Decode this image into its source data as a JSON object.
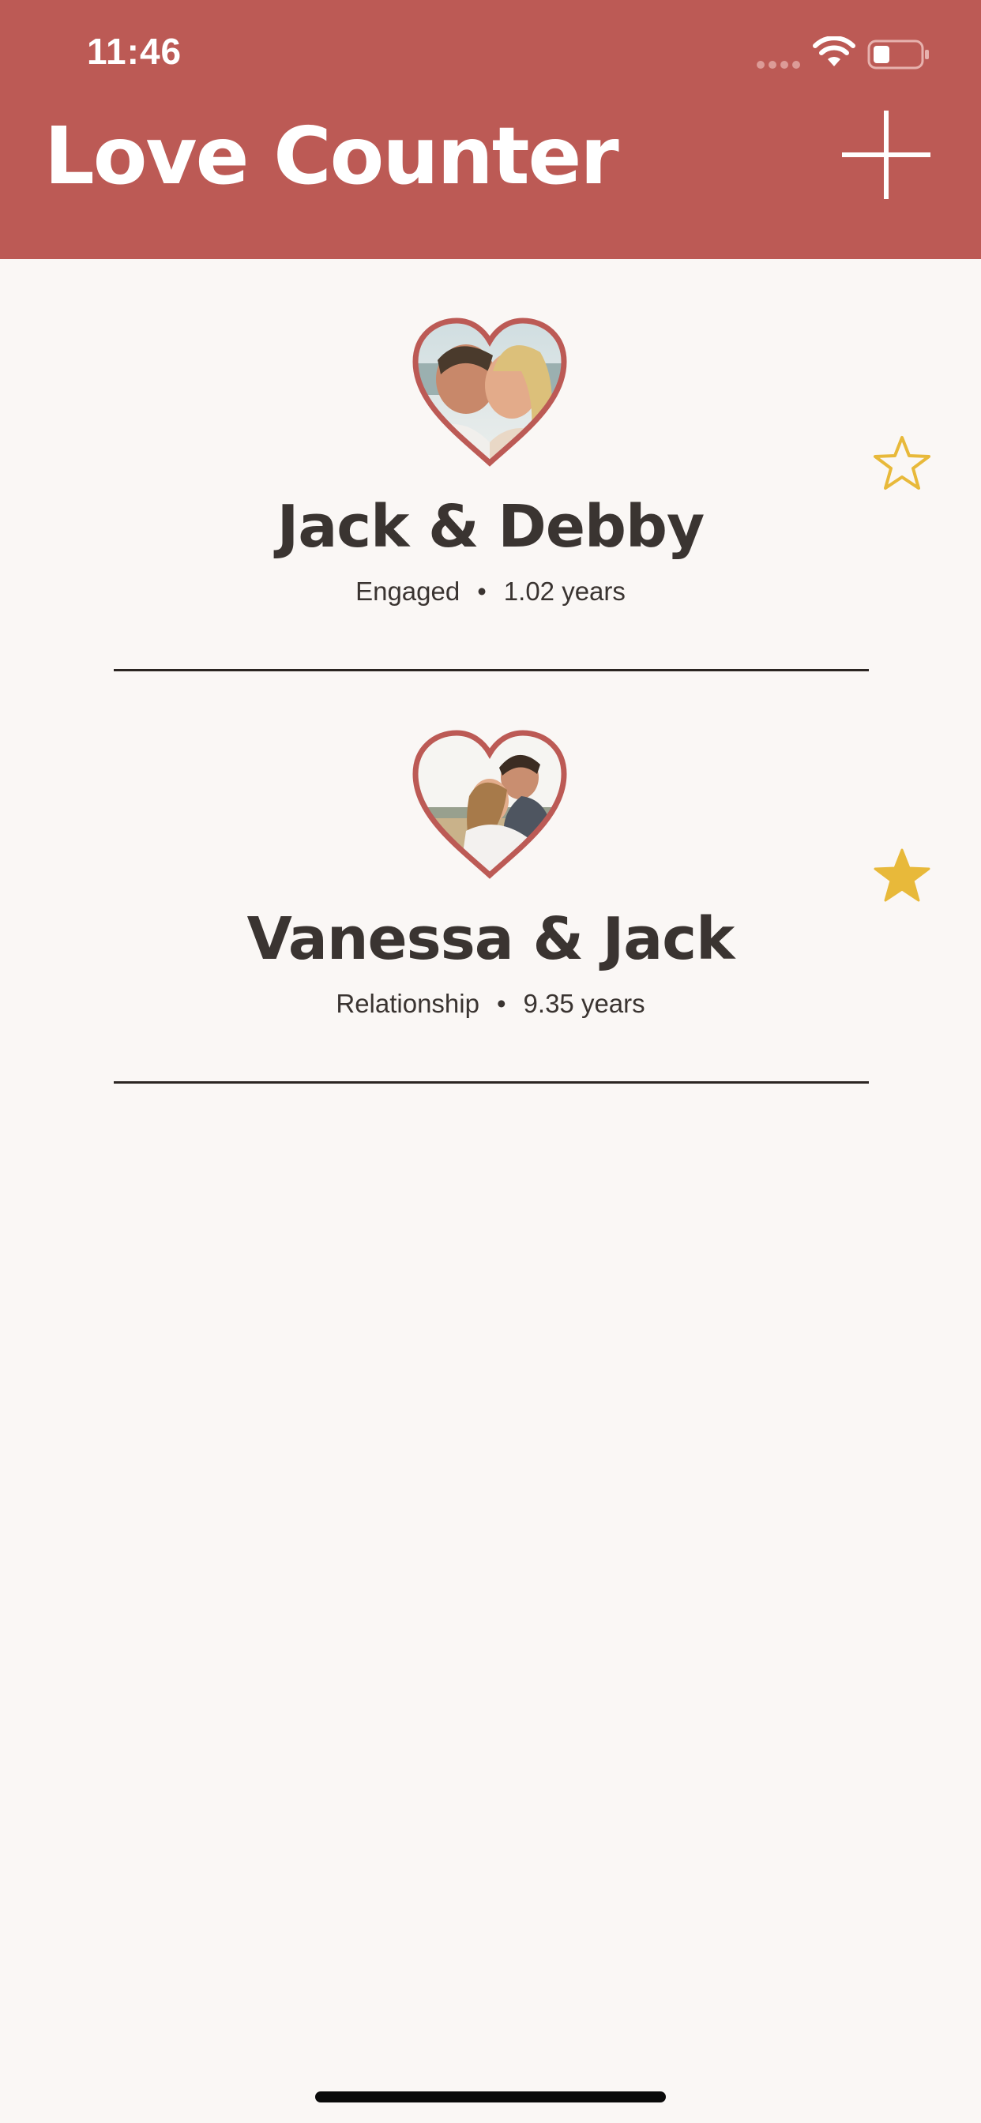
{
  "status_bar": {
    "time": "11:46"
  },
  "header": {
    "title": "Love Counter",
    "add_icon": "plus-icon"
  },
  "couples": [
    {
      "name": "Jack & Debby",
      "status": "Engaged",
      "separator": "•",
      "duration": "1.02 years",
      "favorite": false,
      "photo_icon": "couple-photo-heart"
    },
    {
      "name": "Vanessa & Jack",
      "status": "Relationship",
      "separator": "•",
      "duration": "9.35 years",
      "favorite": true,
      "photo_icon": "couple-photo-heart"
    }
  ],
  "colors": {
    "brand": "#bc5a55",
    "background": "#faf7f5",
    "star": "#e8b93a",
    "text": "#3a3431"
  }
}
